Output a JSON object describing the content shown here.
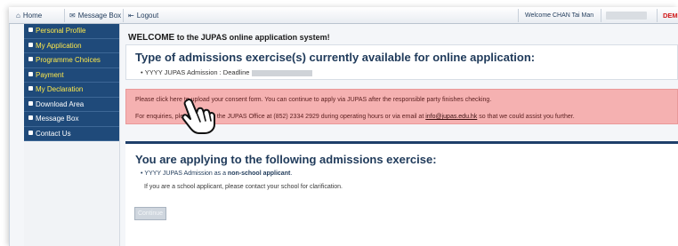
{
  "topnav": {
    "home": "Home",
    "messagebox": "Message Box",
    "logout": "Logout",
    "welcome": "Welcome CHAN Tai Man",
    "demo": "DEM"
  },
  "sidebar": {
    "items": [
      {
        "label": "Personal Profile",
        "highlight": true
      },
      {
        "label": "My Application",
        "highlight": true
      },
      {
        "label": "Programme Choices",
        "highlight": true
      },
      {
        "label": "Payment",
        "highlight": true
      },
      {
        "label": "My Declaration",
        "highlight": true
      },
      {
        "label": "Download Area",
        "highlight": false
      },
      {
        "label": "Message Box",
        "highlight": false
      },
      {
        "label": "Contact Us",
        "highlight": false
      }
    ]
  },
  "main": {
    "welcome_bold": "WELCOME",
    "welcome_rest": "to the JUPAS online application system!",
    "exercise_title": "Type of admissions exercise(s) currently available for online application:",
    "exercise_item": "YYYY JUPAS Admission : Deadline",
    "alert_line1": "Please click here to upload your consent form. You can continue to apply via JUPAS after the responsible party finishes checking.",
    "alert_line2_a": "For enquiries, please contact the JUPAS Office at (852) 2334 2929 during operating hours or via email at",
    "alert_email": "info@jupas.edu.hk",
    "alert_line2_b": "so that we could assist you further.",
    "applying_title": "You are applying to the following admissions exercise:",
    "applying_item_a": "YYYY JUPAS Admission as a",
    "applying_item_b": "non-school applicant",
    "applying_note": "If you are a school applicant, please contact your school for clarification.",
    "continue_label": "Continue"
  },
  "colors": {
    "sidebar_bg": "#1f4a7a",
    "highlight_text": "#ffe94a",
    "alert_bg": "#f5b1b1",
    "title_color": "#1f3a5a",
    "demo_red": "#d01818"
  },
  "icons": [
    "home-icon",
    "message-box-icon",
    "logout-icon",
    "hand-pointer-icon"
  ]
}
